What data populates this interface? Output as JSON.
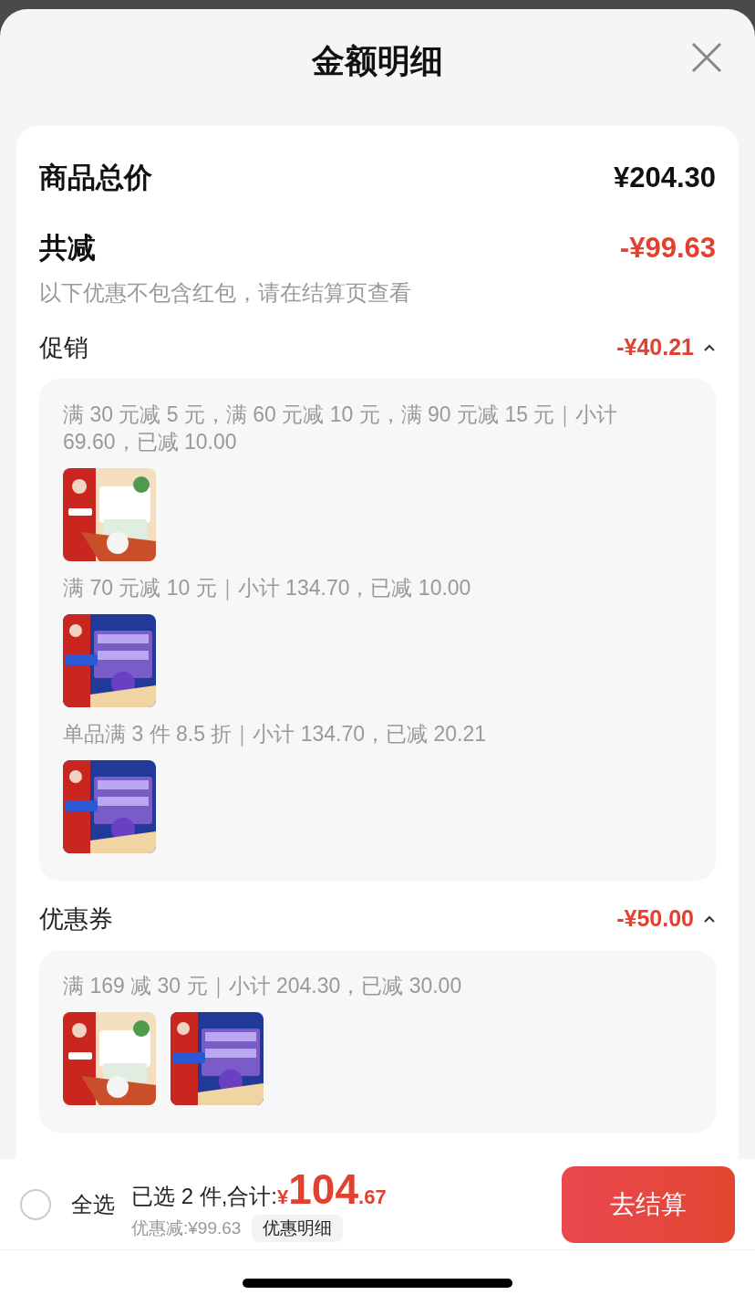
{
  "sheet": {
    "title": "金额明细"
  },
  "summary": {
    "total_label": "商品总价",
    "total": "¥204.30",
    "discount_label": "共减",
    "discount": "-¥99.63",
    "note": "以下优惠不包含红包，请在结算页查看"
  },
  "sections": [
    {
      "title": "促销",
      "amount": "-¥40.21",
      "expanded": true,
      "groups": [
        {
          "rule": "满 30 元减 5 元，满 60 元减 10 元，满 90 元减 15 元｜小计 69.60，已减 10.00"
        },
        {
          "rule": "满 70 元减 10 元｜小计 134.70，已减 10.00"
        },
        {
          "rule": "单品满 3 件 8.5 折｜小计 134.70，已减 20.21"
        }
      ]
    },
    {
      "title": "优惠券",
      "amount": "-¥50.00",
      "expanded": true,
      "groups": [
        {
          "rule": "满 169 减 30 元｜小计 204.30，已减 30.00"
        }
      ]
    }
  ],
  "footer": {
    "select_all": {
      "label": "全选",
      "checked": false
    },
    "selected_label": "已选 2 件,合计:",
    "currency": "¥",
    "price_int": "104",
    "price_dec": ".67",
    "saved": "优惠减:¥99.63",
    "detail_button": "优惠明细",
    "checkout_button": "去结算"
  }
}
